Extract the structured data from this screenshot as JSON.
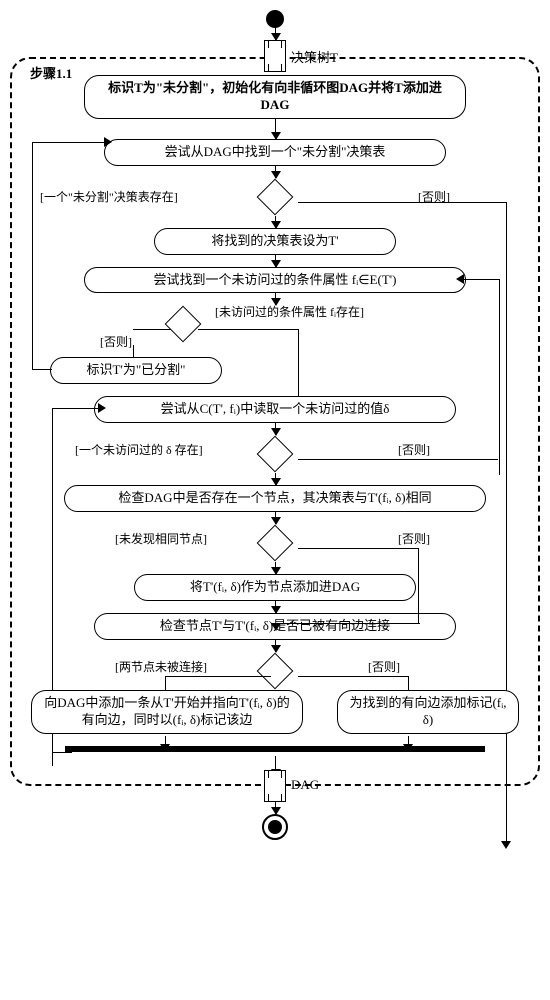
{
  "io_in_label": "决策树T",
  "frame_title": "步骤1.1",
  "n1": "标识T为\"未分割\"，初始化有向非循环图DAG并将T添加进DAG",
  "n2": "尝试从DAG中找到一个\"未分割\"决策表",
  "d1_left": "[一个\"未分割\"决策表存在]",
  "d1_right": "[否则]",
  "n3": "将找到的决策表设为T'",
  "n4": "尝试找到一个未访问过的条件属性 fᵢ∈E(T')",
  "d2_left": "[否则]",
  "d2_right": "[未访问过的条件属性 fᵢ存在]",
  "n5": "标识T'为\"已分割\"",
  "n6": "尝试从C(T', fᵢ)中读取一个未访问过的值δ",
  "d3_left": "[一个未访问过的 δ 存在]",
  "d3_right": "[否则]",
  "n7": "检查DAG中是否存在一个节点，其决策表与T'(fᵢ, δ)相同",
  "d4_left": "[未发现相同节点]",
  "d4_right": "[否则]",
  "n8": "将T'(fᵢ, δ)作为节点添加进DAG",
  "n9": "检查节点T'与T'(fᵢ, δ)是否已被有向边连接",
  "d5_left": "[两节点未被连接]",
  "d5_right": "[否则]",
  "n10": "向DAG中添加一条从T'开始并指向T'(fᵢ, δ)的有向边，同时以(fᵢ, δ)标记该边",
  "n11": "为找到的有向边添加标记(fᵢ, δ)",
  "io_out_label": "DAG"
}
